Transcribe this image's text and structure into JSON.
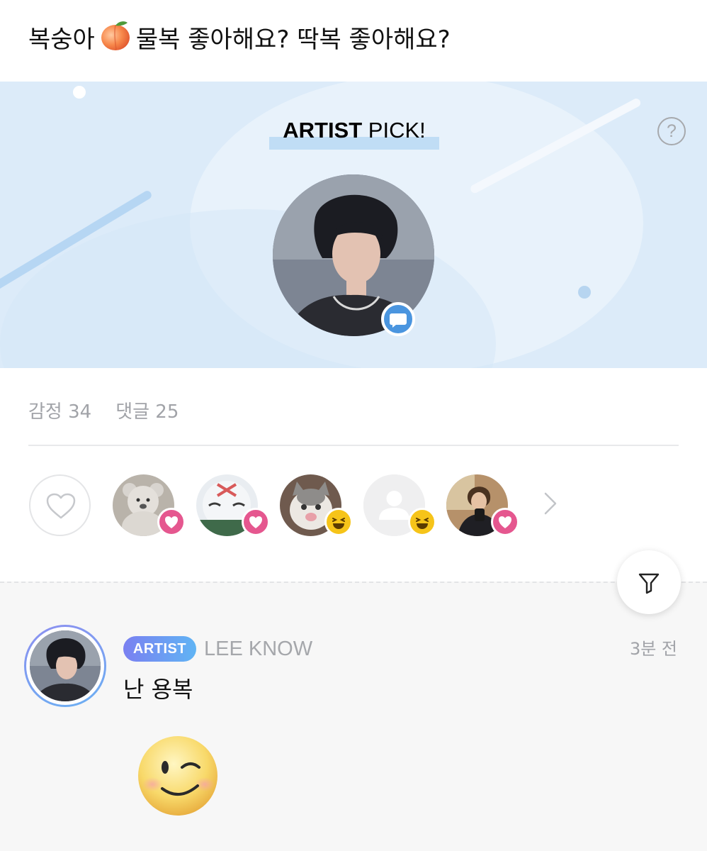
{
  "post": {
    "title_before": "복숭아",
    "title_after": "물복 좋아해요? 딱복 좋아해요?"
  },
  "banner": {
    "title_bold": "ARTIST",
    "title_rest": "PICK!",
    "help_label": "?"
  },
  "stats": {
    "emotions": "감정 34",
    "comments": "댓글 25"
  },
  "reactions": [
    {
      "name": "teddy-bear-avatar",
      "badge": "heart"
    },
    {
      "name": "cartoon-avatar",
      "badge": "heart"
    },
    {
      "name": "cat-avatar",
      "badge": "laugh"
    },
    {
      "name": "default-avatar",
      "badge": "laugh"
    },
    {
      "name": "person-avatar",
      "badge": "heart"
    }
  ],
  "comment": {
    "badge": "ARTIST",
    "author": "LEE KNOW",
    "time": "3분 전",
    "text": "난 용복",
    "sticker": "wink-face"
  },
  "colors": {
    "banner_bg": "#dcebf9",
    "accent_blue": "#4a95df",
    "heart_pink": "#e5578f",
    "laugh_yellow": "#f6c419",
    "muted_text": "#a1a3a8"
  }
}
